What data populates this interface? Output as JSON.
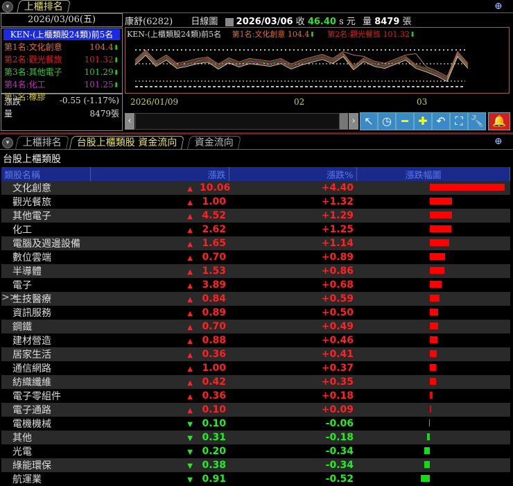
{
  "top": {
    "tab": "上櫃排名",
    "date": "2026/03/06(五)",
    "rank_title": "KEN-(上櫃類股24類)前5名",
    "ranks": [
      {
        "label": "第1名:文化創意",
        "value": "104.4",
        "color": "#e07040"
      },
      {
        "label": "第2名:觀光餐旅",
        "value": "101.32",
        "color": "#e02020"
      },
      {
        "label": "第3名:其他電子",
        "value": "101.29",
        "color": "#30d030"
      },
      {
        "label": "第4名:化工",
        "value": "101.25",
        "color": "#c030c0"
      },
      {
        "label": "第5名:橡膠",
        "value": "",
        "color": "#d8d040"
      }
    ],
    "change_label": "漲跌",
    "change_value": "-0.55 (-1.17%)",
    "vol_label": "量",
    "vol_value": "8479張",
    "stock": "康舒(6282)",
    "chart_type": "日線圖",
    "chart_date": "2026/03/06",
    "close_label": "收",
    "close_value": "46.40",
    "close_suffix": "s 元",
    "volume_label": "量",
    "volume_value": "8479",
    "volume_unit": "張",
    "chart_legend": "KEN-(上櫃類股24類)前5名",
    "legend1": "第1名:文化創意 104.4",
    "legend2": "第2名:觀光餐旅 101.32",
    "x_ticks": [
      "2026/01/09",
      "02",
      "03"
    ]
  },
  "bottom": {
    "tabs": [
      "上櫃排名",
      "台股上櫃類股 資金流向",
      "資金流向"
    ],
    "title": "台股上櫃類股",
    "headers": [
      "類股名稱",
      "漲跌",
      "漲跌%",
      "漲跌幅圖"
    ],
    "rows": [
      {
        "name": "文化創意",
        "chg": "10.06",
        "pct": "+4.40",
        "p": 4.4
      },
      {
        "name": "觀光餐旅",
        "chg": "1.00",
        "pct": "+1.32",
        "p": 1.32
      },
      {
        "name": "其他電子",
        "chg": "4.52",
        "pct": "+1.29",
        "p": 1.29
      },
      {
        "name": "化工",
        "chg": "2.62",
        "pct": "+1.25",
        "p": 1.25
      },
      {
        "name": "電腦及週邊設備",
        "chg": "1.65",
        "pct": "+1.14",
        "p": 1.14
      },
      {
        "name": "數位雲端",
        "chg": "0.70",
        "pct": "+0.89",
        "p": 0.89
      },
      {
        "name": "半導體",
        "chg": "1.53",
        "pct": "+0.86",
        "p": 0.86
      },
      {
        "name": "電子",
        "chg": "3.89",
        "pct": "+0.68",
        "p": 0.68
      },
      {
        "name": "生技醫療",
        "chg": "0.84",
        "pct": "+0.59",
        "p": 0.59,
        "mark": ">>"
      },
      {
        "name": "資訊服務",
        "chg": "0.89",
        "pct": "+0.50",
        "p": 0.5
      },
      {
        "name": "鋼鐵",
        "chg": "0.70",
        "pct": "+0.49",
        "p": 0.49
      },
      {
        "name": "建材營造",
        "chg": "0.88",
        "pct": "+0.46",
        "p": 0.46
      },
      {
        "name": "居家生活",
        "chg": "0.36",
        "pct": "+0.41",
        "p": 0.41
      },
      {
        "name": "通信網路",
        "chg": "1.00",
        "pct": "+0.37",
        "p": 0.37
      },
      {
        "name": "紡織纖維",
        "chg": "0.42",
        "pct": "+0.35",
        "p": 0.35
      },
      {
        "name": "電子零組件",
        "chg": "0.36",
        "pct": "+0.18",
        "p": 0.18
      },
      {
        "name": "電子通路",
        "chg": "0.10",
        "pct": "+0.09",
        "p": 0.09
      },
      {
        "name": "電機機械",
        "chg": "0.10",
        "pct": "-0.06",
        "p": -0.06
      },
      {
        "name": "其他",
        "chg": "0.31",
        "pct": "-0.18",
        "p": -0.18
      },
      {
        "name": "光電",
        "chg": "0.20",
        "pct": "-0.34",
        "p": -0.34
      },
      {
        "name": "綠能環保",
        "chg": "0.38",
        "pct": "-0.34",
        "p": -0.34
      },
      {
        "name": "航運業",
        "chg": "0.91",
        "pct": "-0.52",
        "p": -0.52
      }
    ]
  }
}
